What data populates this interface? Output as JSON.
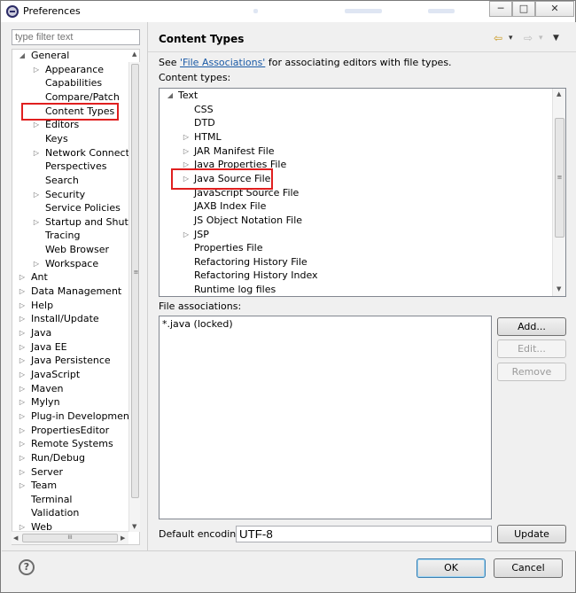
{
  "window": {
    "title": "Preferences",
    "buttons": {
      "minimize": "─",
      "maximize": "□",
      "close": "✕"
    }
  },
  "sidebar": {
    "filter_placeholder": "type filter text",
    "items": [
      {
        "label": "General",
        "expander": "◢"
      },
      {
        "label": "Appearance",
        "expander": "▷"
      },
      {
        "label": "Capabilities",
        "expander": ""
      },
      {
        "label": "Compare/Patch",
        "expander": ""
      },
      {
        "label": "Content Types",
        "expander": ""
      },
      {
        "label": "Editors",
        "expander": "▷"
      },
      {
        "label": "Keys",
        "expander": ""
      },
      {
        "label": "Network Connection",
        "expander": "▷"
      },
      {
        "label": "Perspectives",
        "expander": ""
      },
      {
        "label": "Search",
        "expander": ""
      },
      {
        "label": "Security",
        "expander": "▷"
      },
      {
        "label": "Service Policies",
        "expander": ""
      },
      {
        "label": "Startup and Shutdo",
        "expander": "▷"
      },
      {
        "label": "Tracing",
        "expander": ""
      },
      {
        "label": "Web Browser",
        "expander": ""
      },
      {
        "label": "Workspace",
        "expander": "▷"
      },
      {
        "label": "Ant",
        "expander": "▷"
      },
      {
        "label": "Data Management",
        "expander": "▷"
      },
      {
        "label": "Help",
        "expander": "▷"
      },
      {
        "label": "Install/Update",
        "expander": "▷"
      },
      {
        "label": "Java",
        "expander": "▷"
      },
      {
        "label": "Java EE",
        "expander": "▷"
      },
      {
        "label": "Java Persistence",
        "expander": "▷"
      },
      {
        "label": "JavaScript",
        "expander": "▷"
      },
      {
        "label": "Maven",
        "expander": "▷"
      },
      {
        "label": "Mylyn",
        "expander": "▷"
      },
      {
        "label": "Plug-in Development",
        "expander": "▷"
      },
      {
        "label": "PropertiesEditor",
        "expander": "▷"
      },
      {
        "label": "Remote Systems",
        "expander": "▷"
      },
      {
        "label": "Run/Debug",
        "expander": "▷"
      },
      {
        "label": "Server",
        "expander": "▷"
      },
      {
        "label": "Team",
        "expander": "▷"
      },
      {
        "label": "Terminal",
        "expander": ""
      },
      {
        "label": "Validation",
        "expander": ""
      },
      {
        "label": "Web",
        "expander": "▷"
      }
    ],
    "scroll_thumb_grip": "III",
    "scroll_vgrip": "≡"
  },
  "main": {
    "title": "Content Types",
    "see_prefix": "See ",
    "see_link": "'File Associations'",
    "see_suffix": " for associating editors with file types.",
    "content_types_label": "Content types:",
    "content_types": [
      {
        "label": "Text",
        "expander": "◢"
      },
      {
        "label": "CSS",
        "expander": ""
      },
      {
        "label": "DTD",
        "expander": ""
      },
      {
        "label": "HTML",
        "expander": "▷"
      },
      {
        "label": "JAR Manifest File",
        "expander": "▷"
      },
      {
        "label": "Java Properties File",
        "expander": "▷"
      },
      {
        "label": "Java Source File",
        "expander": "▷"
      },
      {
        "label": "JavaScript Source File",
        "expander": ""
      },
      {
        "label": "JAXB Index File",
        "expander": ""
      },
      {
        "label": "JS Object Notation File",
        "expander": ""
      },
      {
        "label": "JSP",
        "expander": "▷"
      },
      {
        "label": "Properties File",
        "expander": ""
      },
      {
        "label": "Refactoring History File",
        "expander": ""
      },
      {
        "label": "Refactoring History Index",
        "expander": ""
      },
      {
        "label": "Runtime log files",
        "expander": ""
      }
    ],
    "file_assoc_label": "File associations:",
    "file_associations": [
      "*.java (locked)"
    ],
    "buttons": {
      "add": "Add...",
      "edit": "Edit...",
      "remove": "Remove",
      "update": "Update"
    },
    "encoding_label": "Default encoding:",
    "encoding_value": "UTF-8",
    "nav": {
      "back": "⇦",
      "forward": "⇨",
      "dropdown": "▾",
      "menu": "▼"
    }
  },
  "footer": {
    "help": "?",
    "ok": "OK",
    "cancel": "Cancel"
  },
  "colors": {
    "highlight_box": "#e01f1f",
    "link": "#1a5aa6"
  }
}
